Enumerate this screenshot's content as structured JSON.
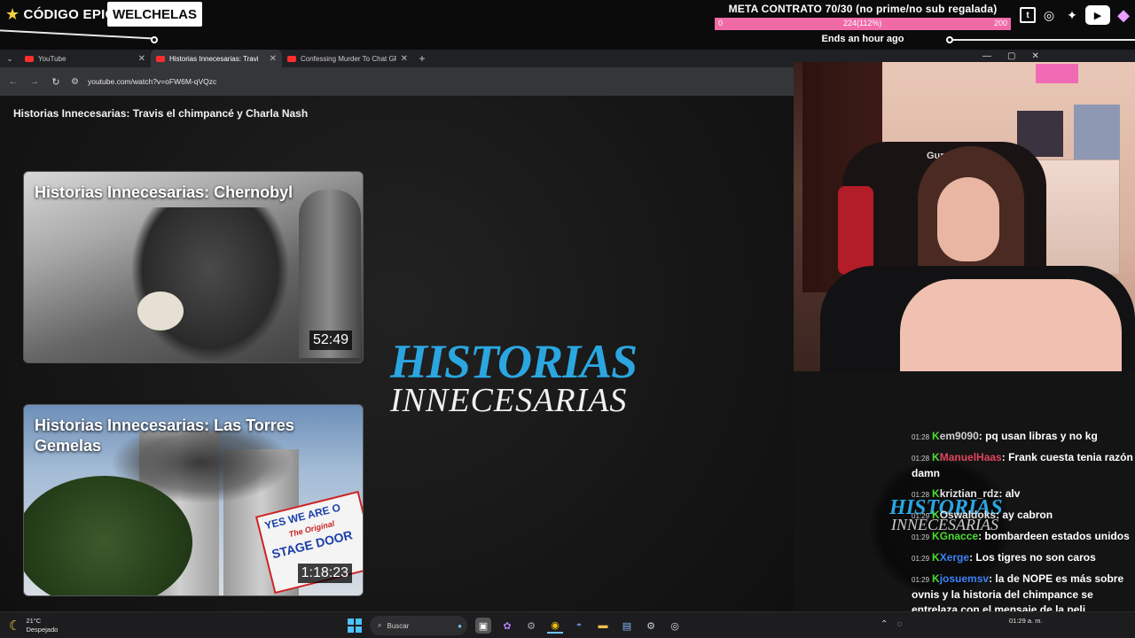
{
  "overlay": {
    "brand": "CÓDIGO EPIC",
    "channel": "WELCHELAS",
    "goal_title": "META CONTRATO 70/30 (no prime/no sub regalada)",
    "goal_min": "0",
    "goal_current": "224(112%)",
    "goal_max": "200",
    "goal_fill_fraction": 1.0,
    "goal_ends": "Ends an hour ago",
    "socials": [
      "twitch-icon",
      "instagram-icon",
      "twitter-icon",
      "youtube-icon",
      "gem-icon"
    ]
  },
  "browser": {
    "tabs": [
      {
        "title": "YouTube",
        "active": false
      },
      {
        "title": "Historias Innecesarias: Travi",
        "active": true
      },
      {
        "title": "Confessing Murder To Chat GP",
        "active": false
      }
    ],
    "url": "youtube.com/watch?v=oFW6M-qVQzc"
  },
  "page": {
    "title": "Historias Innecesarias: Travis el chimpancé y Charla Nash",
    "cards": [
      {
        "title": "Historias Innecesarias: Chernobyl",
        "duration": "52:49"
      },
      {
        "title": "Historias Innecesarias: Las Torres Gemelas",
        "duration": "1:18:23"
      }
    ],
    "logo_line1": "HISTORIAS",
    "logo_line2": "INNECESARIAS",
    "sign_line1": "YES WE ARE O",
    "sign_line2": "The Original",
    "sign_line3": "STAGE DOOR"
  },
  "webcam": {
    "chair_text": "Gurr 10"
  },
  "chat": {
    "logo_line1": "HISTORIAS",
    "logo_line2": "INNECESARIAS",
    "messages": [
      {
        "time": "01:28",
        "user": "em9090",
        "color": "#cfcfcf",
        "text": "pq usan libras y no kg"
      },
      {
        "time": "01:28",
        "user": "ManuelHaas",
        "color": "#e0455c",
        "text": "Frank cuesta tenia razón damn"
      },
      {
        "time": "01:28",
        "user": "kriztian_rdz",
        "color": "#e6e6e6",
        "text": "alv"
      },
      {
        "time": "01:29",
        "user": "Oswaldoks",
        "color": "#e6e6e6",
        "text": "ay cabron"
      },
      {
        "time": "01:29",
        "user": "Gnacce",
        "color": "#4ade30",
        "text": "bombardeen estados unidos"
      },
      {
        "time": "01:29",
        "user": "Xerge",
        "color": "#3b82f6",
        "text": "Los tigres no son caros"
      },
      {
        "time": "01:29",
        "user": "josuemsv",
        "color": "#3b82f6",
        "text": "la de NOPE es más sobre ovnis y la historia del chimpance se entrelaza con el mensaje de la peli"
      }
    ]
  },
  "taskbar": {
    "temp": "21°C",
    "weather": "Despejado",
    "search_placeholder": "Buscar",
    "time": "01:29 a. m."
  }
}
